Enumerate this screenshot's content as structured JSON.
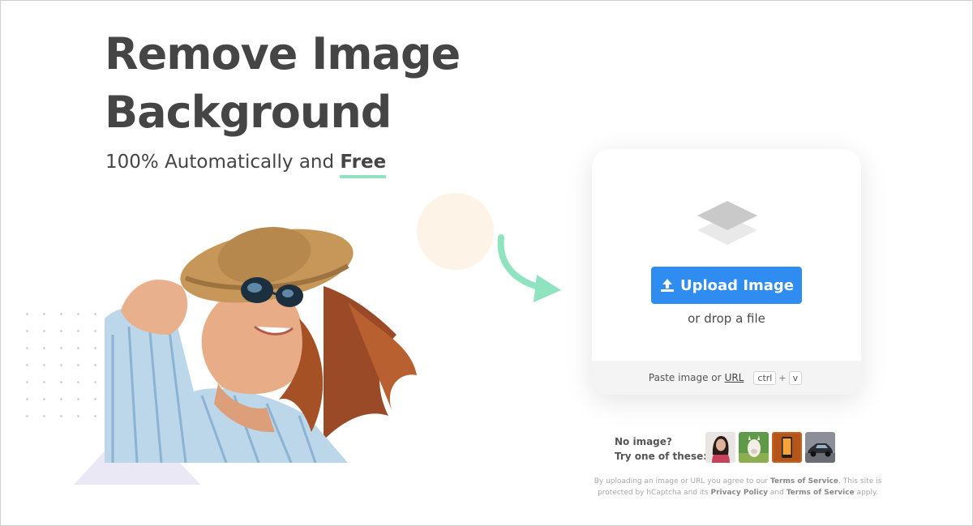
{
  "hero": {
    "title_line1": "Remove Image",
    "title_line2": "Background",
    "subtitle_prefix": "100% Automatically and ",
    "subtitle_emphasis": "Free"
  },
  "upload_card": {
    "button_label": "Upload Image",
    "drop_hint": "or drop a file",
    "paste_text": "Paste image or",
    "url_link": "URL",
    "key_ctrl": "ctrl",
    "key_plus": "+",
    "key_v": "v"
  },
  "samples": {
    "label_line1": "No image?",
    "label_line2": "Try one of these:",
    "items": [
      "sample-woman",
      "sample-alpaca",
      "sample-phone",
      "sample-car"
    ]
  },
  "legal": {
    "part1": "By uploading an image or URL you agree to our ",
    "terms_1": "Terms of Service",
    "part2": ". This site is protected by hCaptcha and its ",
    "privacy": "Privacy Policy",
    "part3": " and ",
    "terms_2": "Terms of Service",
    "part4": " apply."
  },
  "colors": {
    "upload_button": "#2f8cf0",
    "underline_accent": "#8fe3bf",
    "arrow": "#8fe3bf",
    "title_text": "#454545"
  },
  "icons": {
    "upload": "upload-arrow-icon",
    "layers": "layers-icon",
    "arrow": "curved-arrow-icon"
  }
}
